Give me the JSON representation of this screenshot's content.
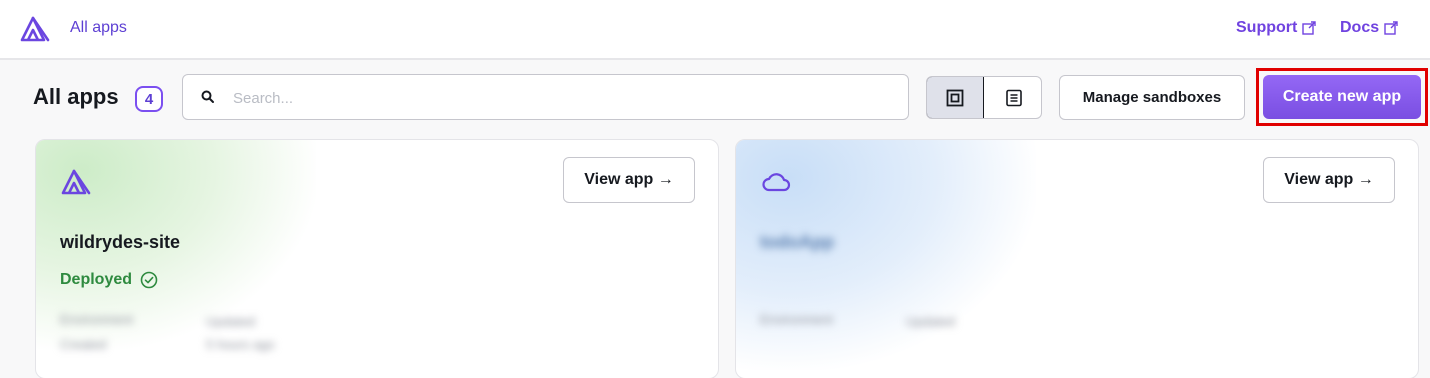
{
  "header": {
    "logo_icon": "amplify-logo-icon",
    "breadcrumb": "All apps",
    "support_label": "Support",
    "docs_label": "Docs",
    "link_color": "#7043e0"
  },
  "toolbar": {
    "title": "All apps",
    "count": "4",
    "search_placeholder": "Search...",
    "view_grid_icon": "grid-view-icon",
    "view_list_icon": "list-view-icon",
    "manage_label": "Manage sandboxes",
    "create_label": "Create new app",
    "accent_color": "#7a4ee2",
    "highlight_color": "#e00000"
  },
  "apps": [
    {
      "name": "wildrydes-site",
      "status": "Deployed",
      "status_color": "#2e8a3f",
      "view_label": "View app →",
      "icon": "amplify-logo-icon",
      "meta": {
        "label_1": "Environment",
        "value_1": "Updated",
        "label_2": "Created",
        "value_2": "5 hours ago"
      }
    },
    {
      "name": "todoApp",
      "status": "",
      "view_label": "View app →",
      "icon": "cloud-icon",
      "meta": {
        "label_1": "Environment",
        "value_1": "Updated"
      }
    }
  ]
}
